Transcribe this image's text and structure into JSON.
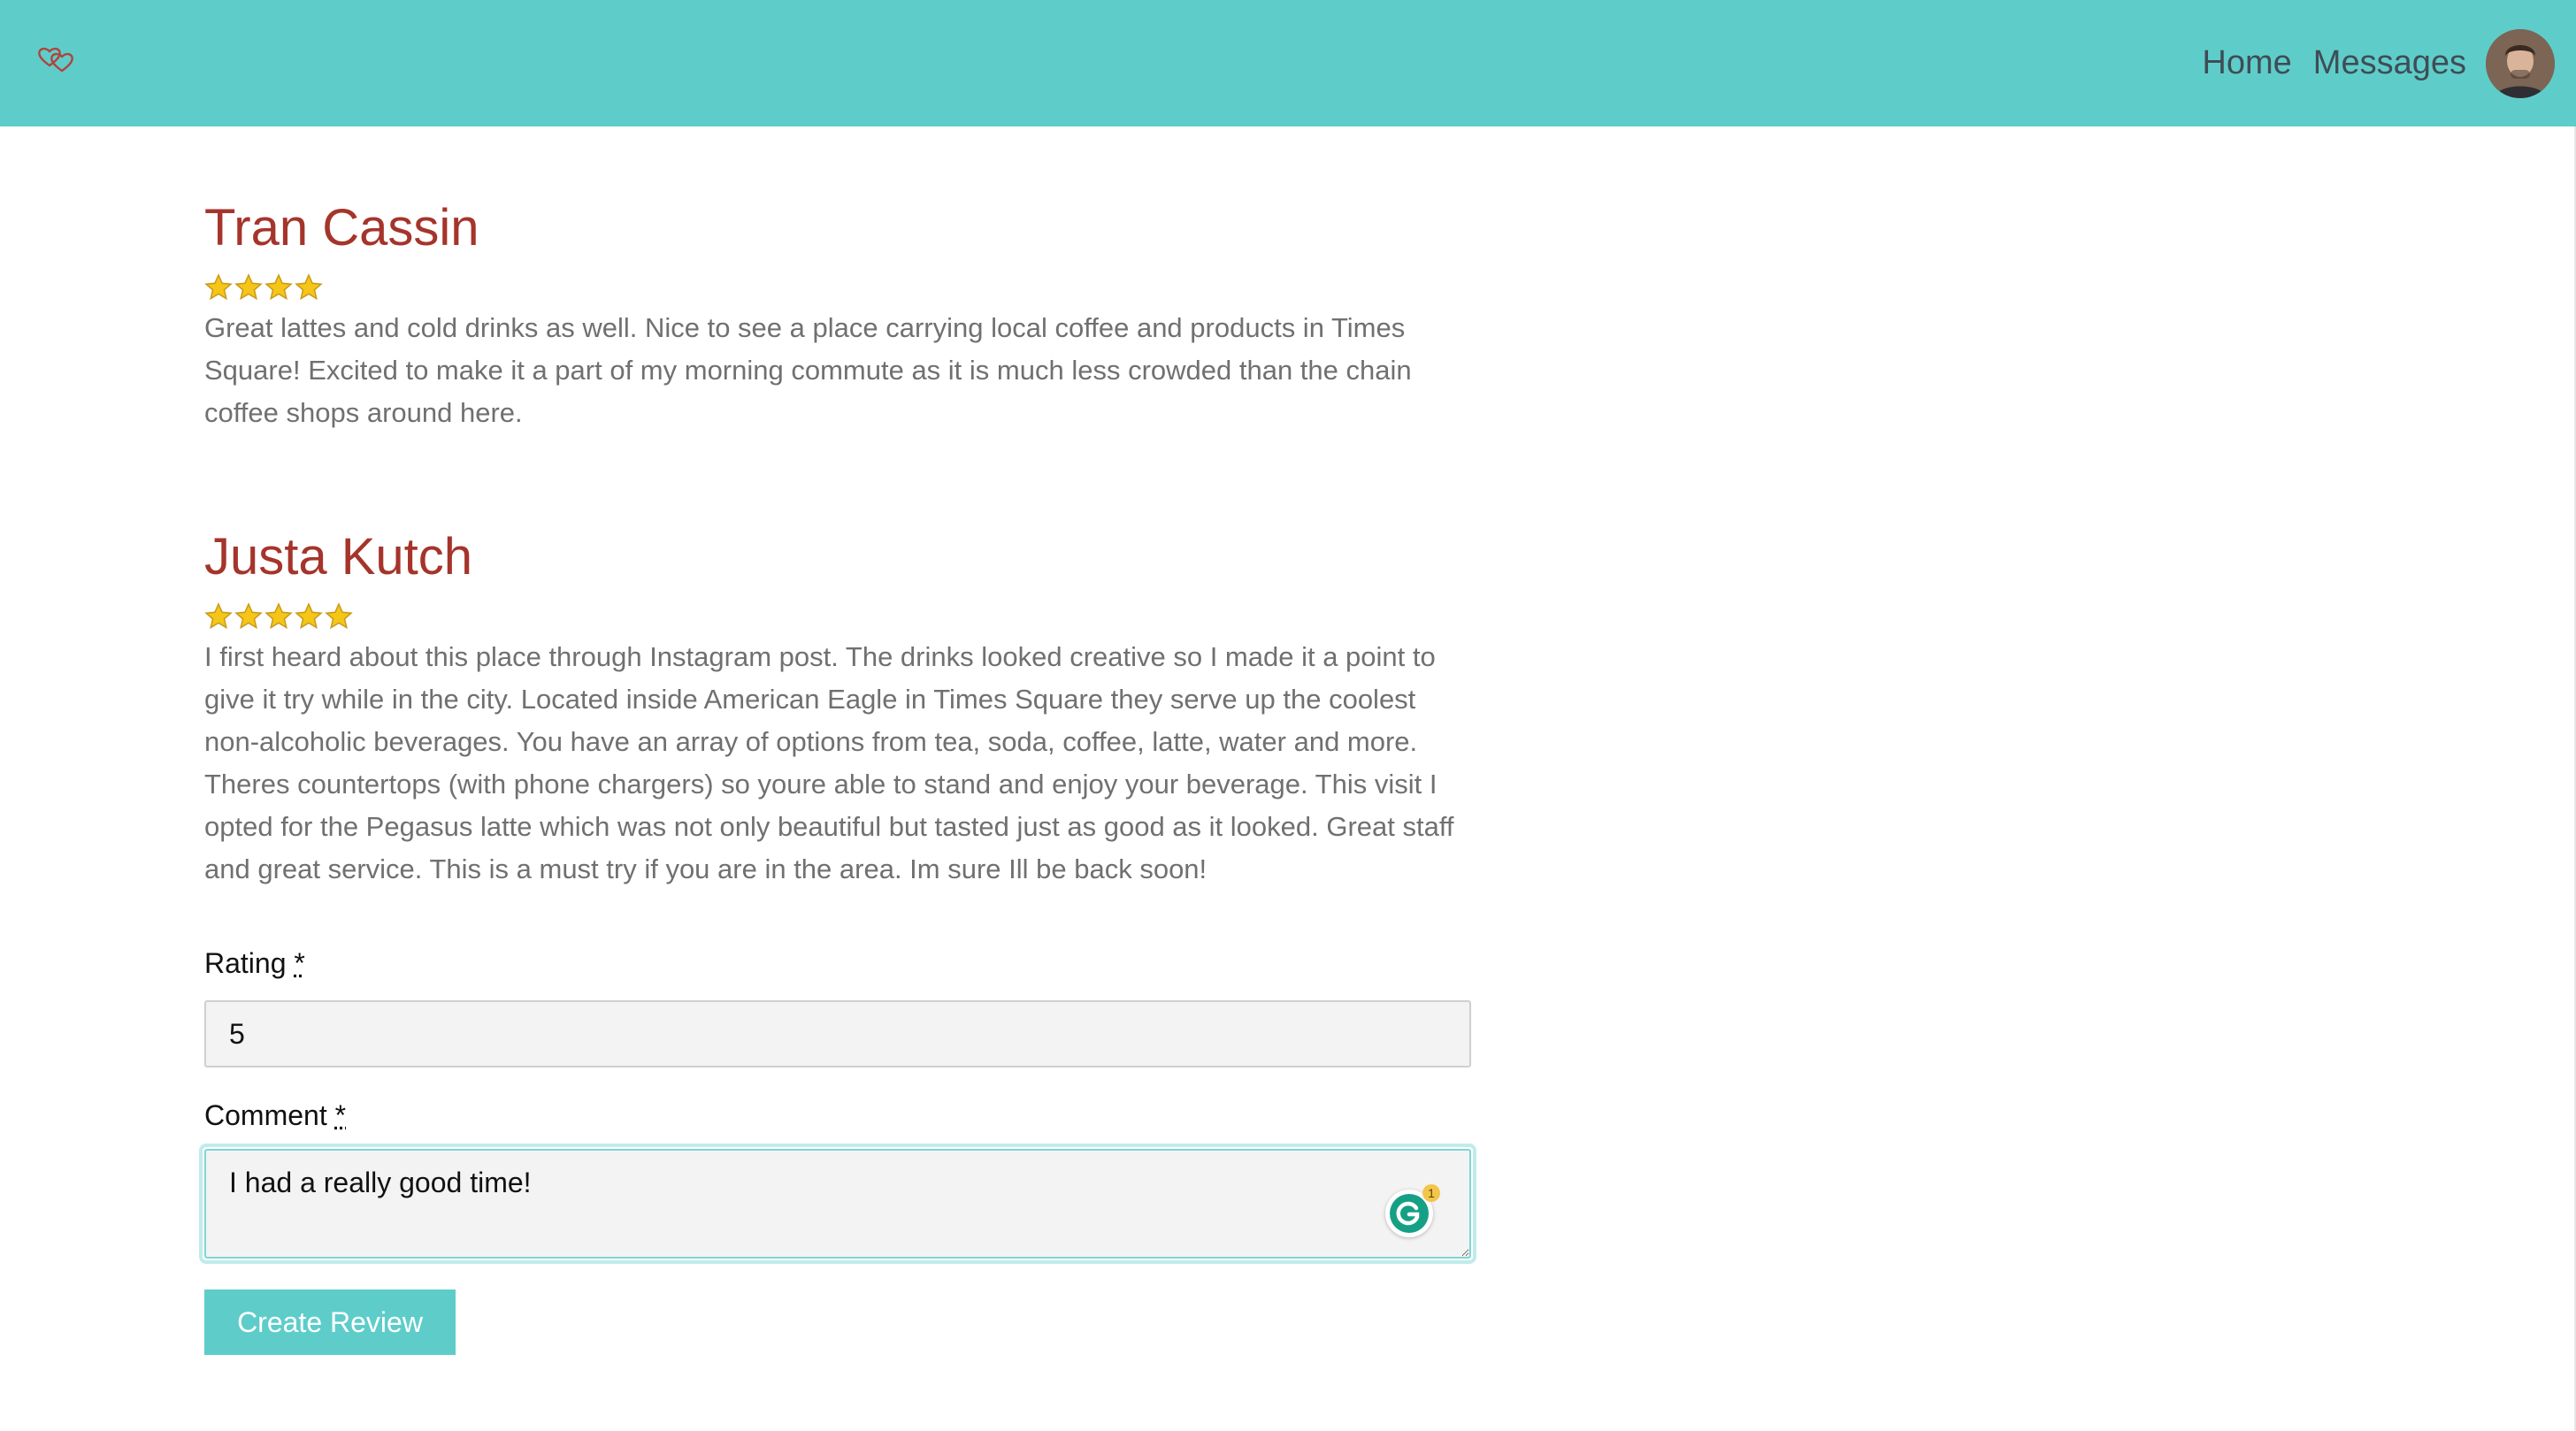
{
  "nav": {
    "logo": "hearts-logo-icon",
    "home_label": "Home",
    "messages_label": "Messages",
    "avatar": "user-avatar"
  },
  "reviews": [
    {
      "name": "Tran Cassin",
      "rating": 4,
      "text": "Great lattes and cold drinks as well. Nice to see a place carrying local coffee and products in Times Square! Excited to make it a part of my morning commute as it is much less crowded than the chain coffee shops around here."
    },
    {
      "name": "Justa Kutch",
      "rating": 5,
      "text": "I first heard about this place through Instagram post. The drinks looked creative so I made it a point to give it try while in the city. Located inside American Eagle in Times Square they serve up the coolest non-alcoholic beverages. You have an array of options from tea, soda, coffee, latte, water and more. Theres countertops (with phone chargers) so youre able to stand and enjoy your beverage. This visit I opted for the Pegasus latte which was not only beautiful but tasted just as good as it looked. Great staff and great service. This is a must try if you are in the area. Im sure Ill be back soon!"
    }
  ],
  "form": {
    "rating_label": "Rating",
    "rating_required": "*",
    "rating_value": "5",
    "comment_label": "Comment",
    "comment_required": "*",
    "comment_value": "I had a really good time!",
    "grammarly_badge": "1",
    "submit_label": "Create Review"
  },
  "colors": {
    "navbar": "#5ecdca",
    "review_name": "#a5342b",
    "star": "#f5c518",
    "button": "#5ecdca"
  }
}
